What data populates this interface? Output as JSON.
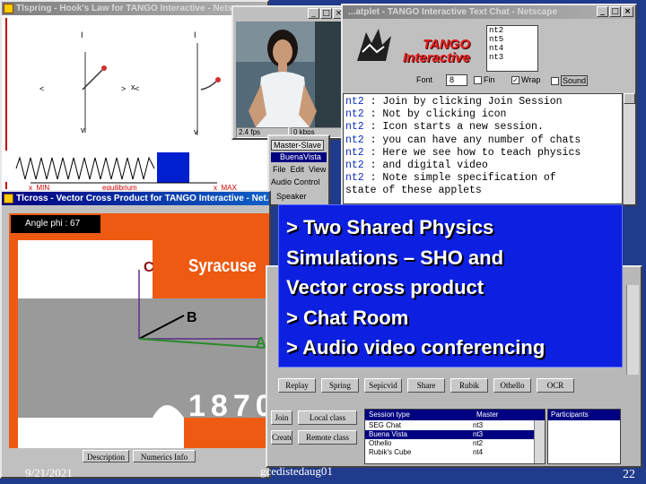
{
  "hooke": {
    "title": "Tlspring - Hook's Law for TANGO Interactive - Netscape",
    "equilibrium": "equilibrium",
    "xmin": "x_MIN",
    "xmax": "x_MAX"
  },
  "video": {
    "fps": "2.4 fps",
    "kbps": "0 kbps"
  },
  "chat": {
    "title": "...atplet - TANGO Interactive Text Chat - Netscape",
    "logo": "TANGO Interactive",
    "font_label": "Font",
    "font_size": "8",
    "checkbox_fin": "Fin",
    "checkbox_wrap": "Wrap",
    "checkbox_sound": "Sound",
    "users": [
      "nt2",
      "nt5",
      "nt4",
      "nt3"
    ],
    "lines": [
      {
        "user": "nt2",
        "text": ": Join by clicking Join Session"
      },
      {
        "user": "nt2",
        "text": ": Not by clicking icon"
      },
      {
        "user": "nt2",
        "text": ": Icon starts a new session."
      },
      {
        "user": "nt2",
        "text": ": you can have any number of chats"
      },
      {
        "user": "nt2",
        "text": ": Here we see how to teach physics"
      },
      {
        "user": "nt2",
        "text": ": and digital video"
      },
      {
        "user": "nt2",
        "text": ": Note simple specification of"
      },
      {
        "user": "",
        "text": "state of these applets"
      }
    ]
  },
  "controls": {
    "master_slave": "Master-Slave",
    "buena_vista": "BuenaVista",
    "menu": [
      "File",
      "Edit",
      "View"
    ],
    "audio_control": "Audio Control",
    "speaker": "Speaker"
  },
  "vector": {
    "title": "Tlcross - Vector Cross Product for TANGO Interactive - Net...",
    "angle": "Angle phi : 67",
    "label_c": "C",
    "label_b": "B",
    "label_a": "A",
    "syracuse": "Syracuse",
    "year": "1870",
    "description_btn": "Description",
    "numerics_btn": "Numerics Info"
  },
  "sessions": {
    "tools": [
      "Replay",
      "Spring",
      "Sepicvid",
      "Share",
      "Rubik",
      "Othello",
      "OCR"
    ],
    "local_btn": "Local class",
    "remote_btn": "Remote class",
    "join_btn": "Join session",
    "create_btn": "Create session",
    "headers": [
      "Session type",
      "Master",
      "Participants"
    ],
    "rows": [
      {
        "type": "SEG Chat",
        "master": "nt3",
        "selected": false
      },
      {
        "type": "Buena Vista",
        "master": "nt3",
        "selected": true
      },
      {
        "type": "Othello",
        "master": "nt2",
        "selected": false
      },
      {
        "type": "Rubik's Cube",
        "master": "nt4",
        "selected": false
      }
    ]
  },
  "slide": {
    "bullets": [
      "> Two Shared Physics",
      "Simulations – SHO and",
      "Vector cross product",
      "> Chat Room",
      "> Audio video conferencing"
    ],
    "date": "9/21/2021",
    "footer": "gcedistedaug01",
    "page": "22"
  },
  "colors": {
    "slide_bg": "#203a8c",
    "callout_bg": "#0d1fe0",
    "syracuse_orange": "#ee5a12"
  }
}
